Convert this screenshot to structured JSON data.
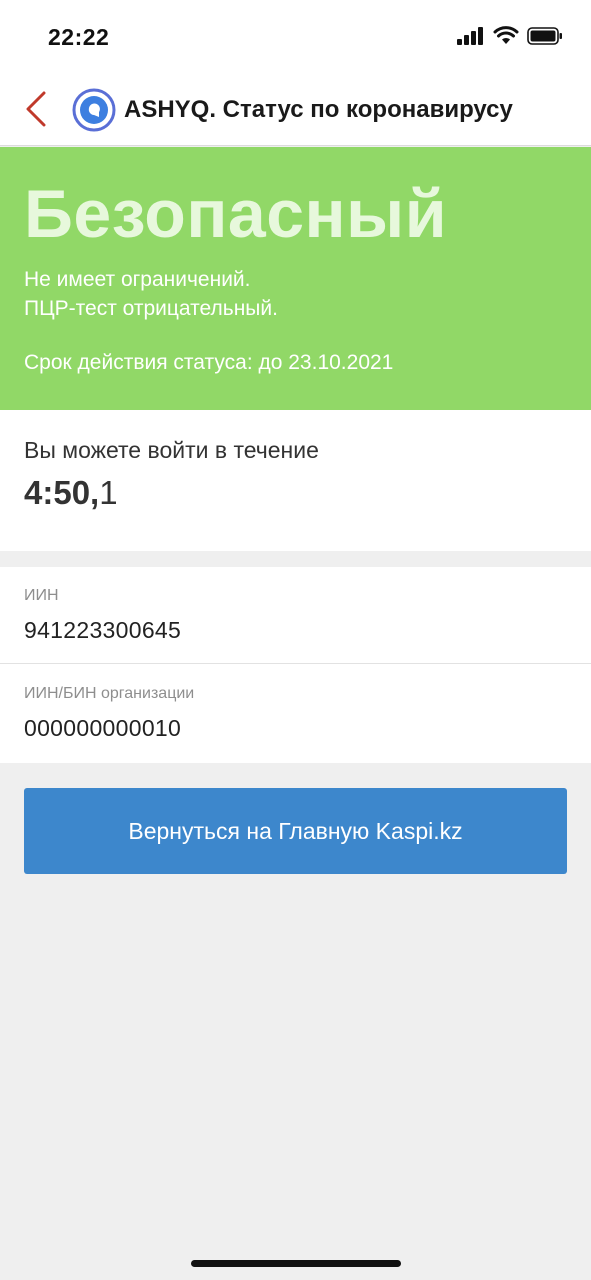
{
  "status_bar": {
    "time": "22:22"
  },
  "nav": {
    "title": "ASHYQ. Статус по коронавирусу",
    "back_icon": "chevron-left-icon",
    "logo_icon": "ashyq-logo-icon"
  },
  "status": {
    "heading": "Безопасный",
    "line1": "Не имеет ограничений.",
    "line2": "ПЦР-тест отрицательный.",
    "validity": "Срок действия статуса: до 23.10.2021"
  },
  "timer": {
    "label": "Вы можете войти в течение",
    "minutes_seconds": "4:50,",
    "fraction": "1"
  },
  "info": {
    "iin_label": "ИИН",
    "iin_value": "941223300645",
    "org_label": "ИИН/БИН организации",
    "org_value": "000000000010"
  },
  "button": {
    "label": "Вернуться на Главную Kaspi.kz"
  },
  "colors": {
    "status_green": "#91d867",
    "button_blue": "#3d87cc",
    "back_red": "#c0392b"
  }
}
